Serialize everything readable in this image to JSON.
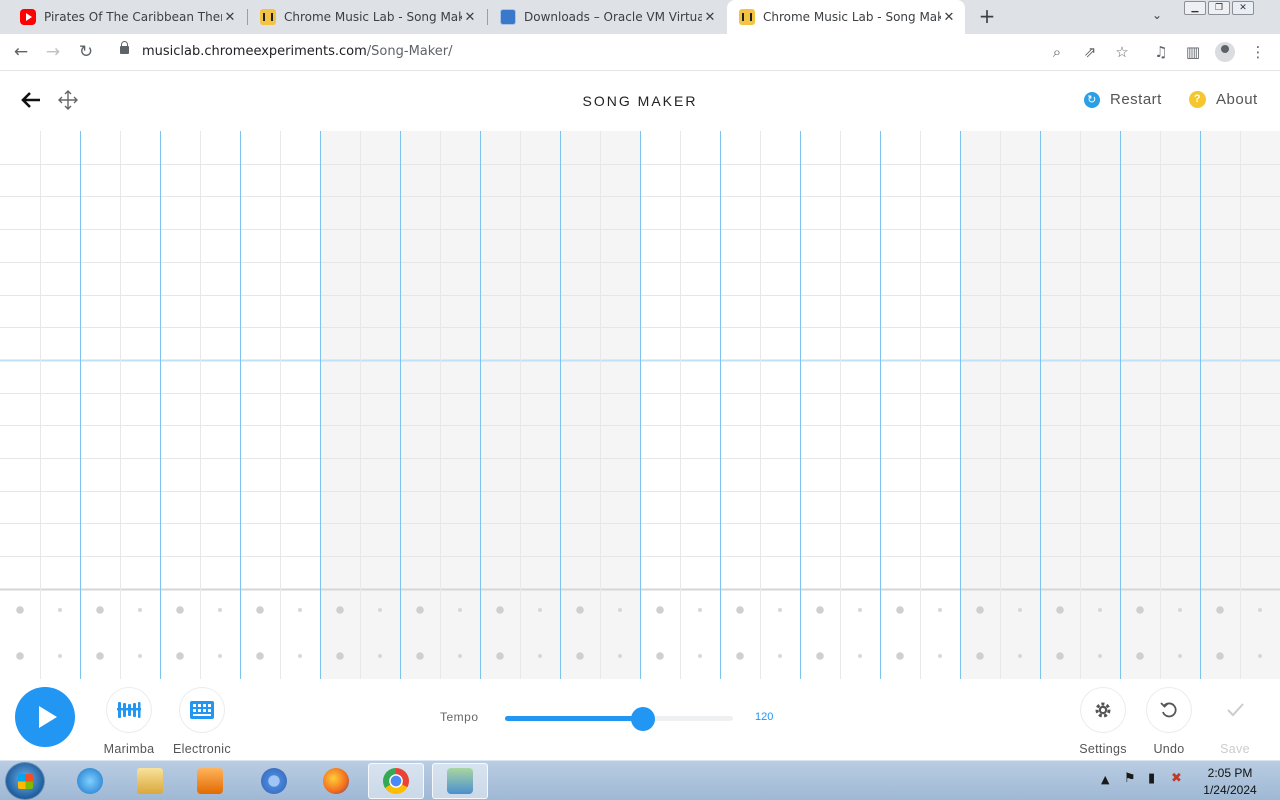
{
  "browser": {
    "tabs": [
      {
        "title": "Pirates Of The Caribbean Theme",
        "favicon": "youtube-icon"
      },
      {
        "title": "Chrome Music Lab - Song Maker",
        "favicon": "chrome-music-lab-icon"
      },
      {
        "title": "Downloads – Oracle VM VirtualBox",
        "favicon": "virtualbox-icon"
      },
      {
        "title": "Chrome Music Lab - Song Maker",
        "favicon": "chrome-music-lab-icon",
        "active": true
      }
    ],
    "url_domain": "musiclab.chromeexperiments.com",
    "url_path": "/Song-Maker/"
  },
  "app": {
    "title": "SONG MAKER",
    "restart_label": "Restart",
    "about_label": "About"
  },
  "controls": {
    "instrument_label": "Marimba",
    "percussion_label": "Electronic",
    "tempo_label": "Tempo",
    "tempo_value": "120",
    "tempo_fraction": 0.605,
    "settings_label": "Settings",
    "undo_label": "Undo",
    "save_label": "Save"
  },
  "colors": {
    "accent": "#2196f3",
    "about_yellow": "#f6c62e"
  },
  "taskbar": {
    "apps": [
      "internet-explorer-icon",
      "file-explorer-icon",
      "media-player-icon",
      "chromium-icon",
      "firefox-icon",
      "chrome-icon",
      "users-icon"
    ],
    "time": "2:05 PM",
    "date": "1/24/2024"
  }
}
